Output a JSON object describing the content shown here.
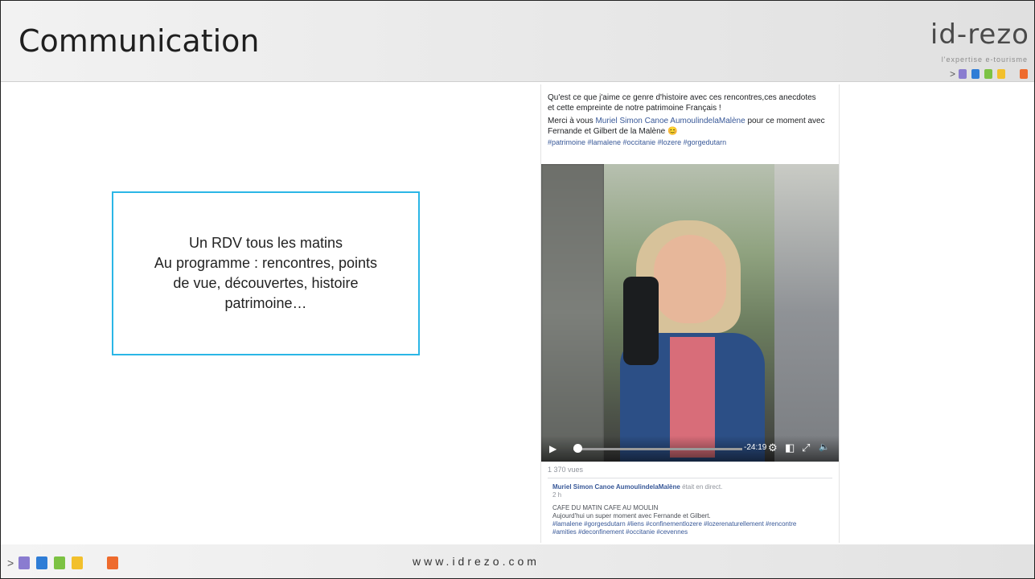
{
  "header": {
    "title": "Communication"
  },
  "logo": {
    "text": "id-rezo",
    "tagline": "l'expertise e-tourisme",
    "chevron": ">",
    "squares": [
      "#8a7cd0",
      "#2f7dd6",
      "#7cc243",
      "#f2c02c",
      "#ee6b2d"
    ]
  },
  "textbox": {
    "line1": "Un RDV tous les matins",
    "line2": "Au programme : rencontres, points",
    "line3": "de vue, découvertes, histoire",
    "line4": "patrimoine…"
  },
  "post": {
    "line1": "Qu'est ce que j'aime ce genre d'histoire avec ces rencontres,ces anecdotes",
    "line2": "et cette empreinte de notre patrimoine Français !",
    "merci_prefix": "Merci à vous ",
    "merci_link": "Muriel Simon Canoe AumoulindelaMalène",
    "merci_suffix": " pour ce moment avec",
    "line4": "Fernande et Gilbert de la Malène 😊",
    "hashtags": "#patrimoine #lamalene #occitanie #lozere #gorgedutarn"
  },
  "video": {
    "play_icon": "▶",
    "time": "-24:19",
    "settings_icon": "⚙",
    "pip_icon": "◧",
    "fullscreen_icon": "⤢",
    "volume_icon": "🔈"
  },
  "views": "1 370 vues",
  "comment": {
    "author": "Muriel Simon Canoe AumoulindelaMalène",
    "status": " était en direct.",
    "age": "2 h",
    "line1": "CAFE DU MATIN CAFE AU MOULIN",
    "line2": "Aujourd'hui un super moment avec Fernande et Gilbert.",
    "line3": "#lamalene #gorgesdutarn #liens #confinementlozere #lozerenaturellement #rencontre",
    "line4": "#amities #deconfinement #occitanie #cevennes"
  },
  "footer": {
    "chevron": ">",
    "url": "www.idrezo.com"
  }
}
